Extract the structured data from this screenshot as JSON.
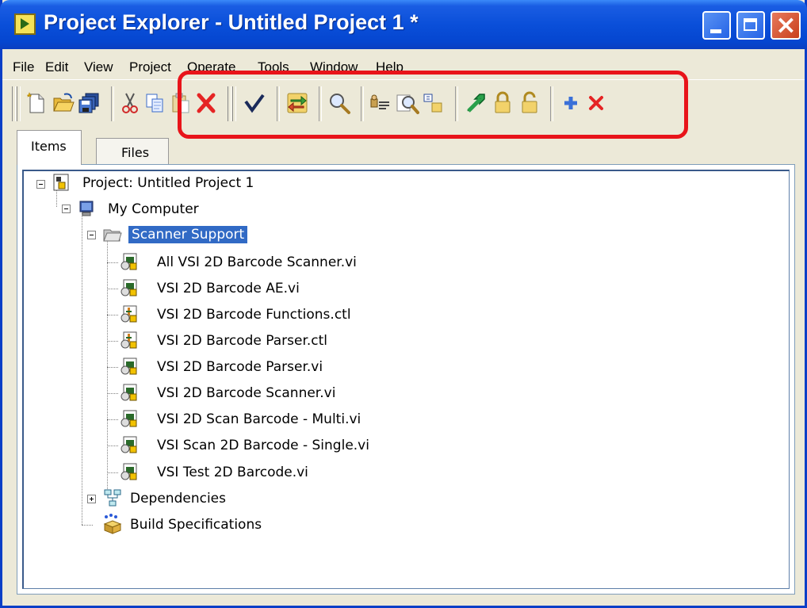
{
  "window": {
    "title": "Project Explorer - Untitled Project 1 *"
  },
  "menu": [
    {
      "label": "File"
    },
    {
      "label": "Edit"
    },
    {
      "label": "View"
    },
    {
      "label": "Project"
    },
    {
      "label": "Operate"
    },
    {
      "label": "Tools"
    },
    {
      "label": "Window"
    },
    {
      "label": "Help"
    }
  ],
  "toolbar": {
    "buttons": [
      "new-icon",
      "open-icon",
      "save-all-icon",
      "cut-icon",
      "copy-icon",
      "paste-icon",
      "delete-icon",
      "check-icon",
      "refresh-icon",
      "find-icon",
      "properties-icon",
      "find-items-icon",
      "arrange-icon",
      "go-icon",
      "lock-icon",
      "unlock-icon",
      "add-icon",
      "remove-icon"
    ]
  },
  "tabs": [
    {
      "label": "Items"
    },
    {
      "label": "Files"
    }
  ],
  "tree": {
    "project": "Project: Untitled Project 1",
    "computer": "My Computer",
    "folder": "Scanner Support",
    "files": [
      "All VSI 2D Barcode Scanner.vi",
      "VSI 2D Barcode AE.vi",
      "VSI 2D Barcode Functions.ctl",
      "VSI 2D Barcode Parser.ctl",
      "VSI 2D Barcode Parser.vi",
      "VSI 2D Barcode Scanner.vi",
      "VSI 2D Scan Barcode - Multi.vi",
      "VSI Scan 2D Barcode - Single.vi",
      "VSI Test 2D Barcode.vi"
    ],
    "dependencies": "Dependencies",
    "build": "Build Specifications"
  },
  "colors": {
    "titlebar": "#0a4fd9",
    "selection": "#316ac5",
    "annotation": "#e8141a"
  }
}
